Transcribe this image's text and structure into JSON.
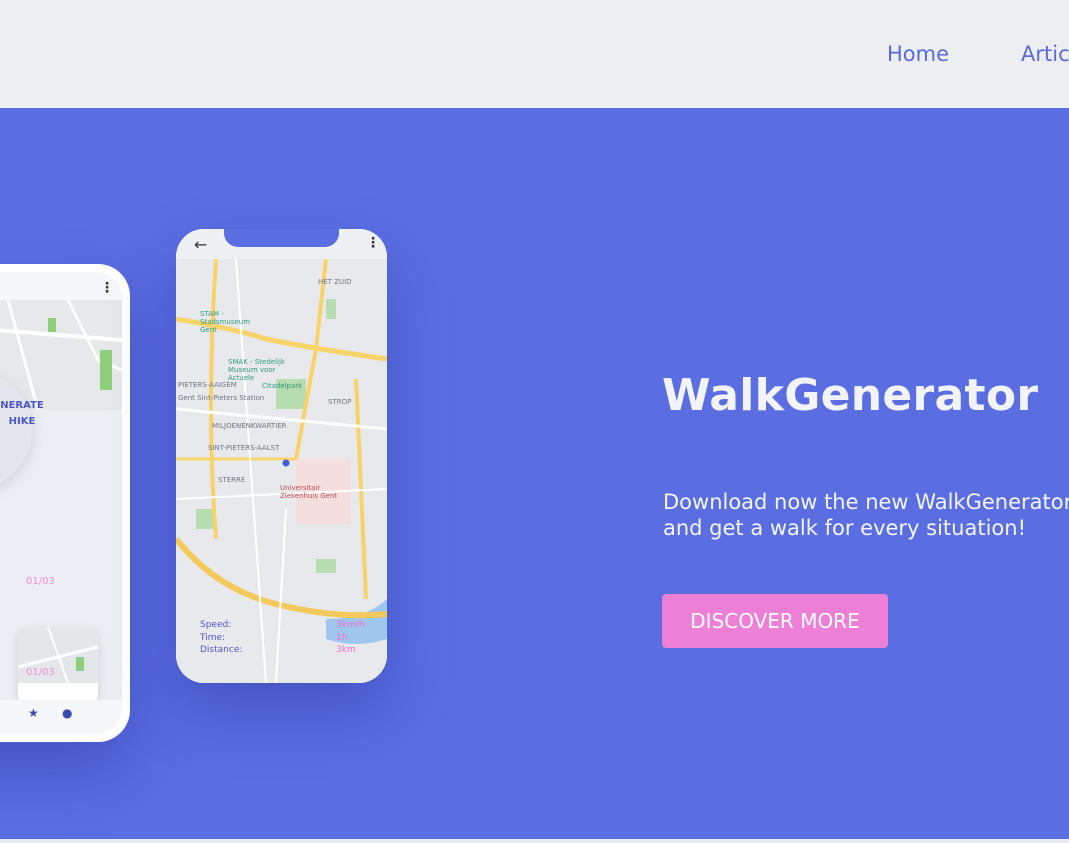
{
  "nav": {
    "home": "Home",
    "articles": "Artic"
  },
  "hero": {
    "title": "WalkGenerator",
    "description": "Download now the new WalkGenerator app and get a walk for every situation!",
    "cta": "DISCOVER MORE"
  },
  "phone_map": {
    "map_labels": {
      "het_zuid": "HET ZUID",
      "stam": "STAM - Stadsmuseum Gent",
      "smak": "SMAK - Stedelijk Museum voor Actuele",
      "citadelpark": "Citadelpark",
      "strop": "STROP",
      "miljoenenkwartier": "MILJOENENKWARTIER",
      "sint_pieters_aalst": "SINT-PIETERS-AALST",
      "sterre": "STERRE",
      "universitair": "Universitair Ziekenhuis Gent",
      "sint_pieters_station": "Gent Sint-Pieters Station",
      "pieters_aaigem": "PIETERS-AAIGEM"
    },
    "stats": [
      {
        "label": "Speed:",
        "value": "3km/h"
      },
      {
        "label": "Time:",
        "value": "1h"
      },
      {
        "label": "Distance:",
        "value": "3km"
      }
    ]
  },
  "phone_app": {
    "generate_label": "NERATE HIKE",
    "tiles": [
      "01/03",
      "01/03"
    ]
  },
  "colors": {
    "hero_bg": "#5a6ee2",
    "cta_bg": "#ee7fd6",
    "nav_text": "#5a6bd6",
    "header_bg": "#eceef2"
  }
}
